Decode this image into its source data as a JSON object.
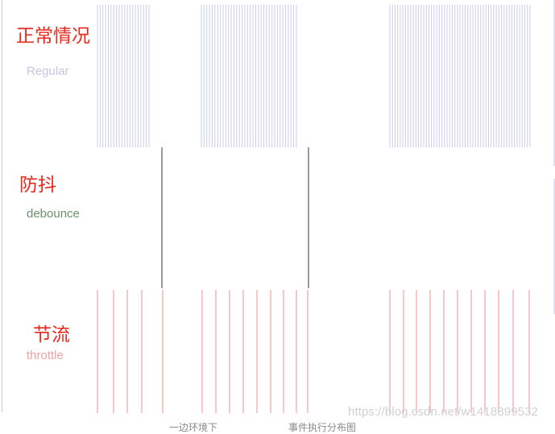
{
  "rows": [
    {
      "id": "regular",
      "label_cn": "正常情况",
      "label_en": "Regular",
      "color": "#c9cdee",
      "event_bursts": [
        {
          "start": 121,
          "end": 185,
          "count": 20
        },
        {
          "start": 250,
          "end": 368,
          "count": 36
        },
        {
          "start": 484,
          "end": 568,
          "count": 27
        },
        {
          "start": 571,
          "end": 658,
          "count": 28
        }
      ]
    },
    {
      "id": "debounce",
      "label_cn": "防抖",
      "label_en": "debounce",
      "color": "#9a9a9a",
      "label_en_color": "#6b8f6b",
      "events": [
        201,
        383
      ]
    },
    {
      "id": "throttle",
      "label_cn": "节流",
      "label_en": "throttle",
      "color": "#f3a3a3",
      "events": [
        121,
        141,
        158,
        176,
        202,
        251,
        268,
        285,
        302,
        319,
        336,
        352,
        368,
        382,
        484,
        501,
        517,
        534,
        551,
        568,
        585,
        602,
        619,
        637,
        657
      ]
    }
  ],
  "watermark": "https://blog.csdn.net/w1418899532",
  "footer_captions": [
    "一边环境下",
    "事件执行分布图"
  ]
}
